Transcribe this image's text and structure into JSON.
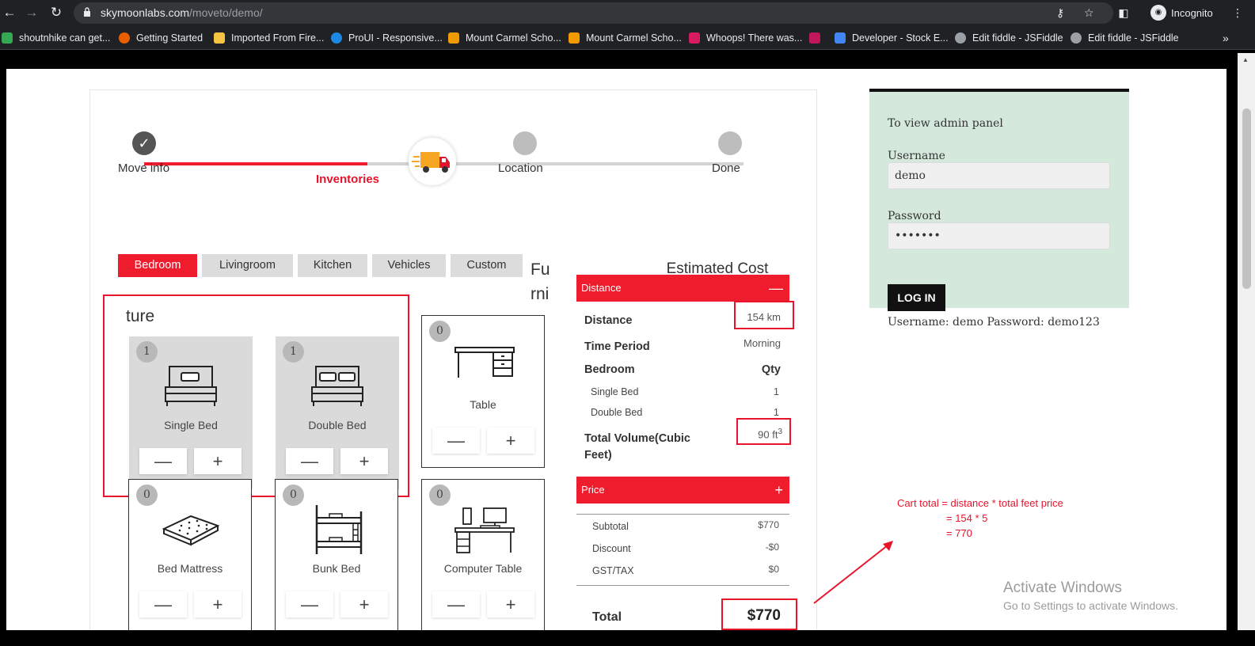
{
  "browser": {
    "url_host": "skymoonlabs.com",
    "url_path": "/moveto/demo/",
    "profile": "Incognito"
  },
  "bookmarks": [
    {
      "label": "shoutnhike can get...",
      "icon": "leaf-icon",
      "color": "#34a853"
    },
    {
      "label": "Getting Started",
      "icon": "firefox-icon",
      "color": "#e66000"
    },
    {
      "label": "Imported From Fire...",
      "icon": "folder-icon",
      "color": "#f6c344"
    },
    {
      "label": "ProUI - Responsive...",
      "icon": "bolt-icon",
      "color": "#1e88e5"
    },
    {
      "label": "Mount Carmel Scho...",
      "icon": "book-icon",
      "color": "#f29900"
    },
    {
      "label": "Mount Carmel Scho...",
      "icon": "book-icon",
      "color": "#f29900"
    },
    {
      "label": "Whoops! There was...",
      "icon": "app-icon",
      "color": "#d81b60"
    },
    {
      "label": "",
      "icon": "app-icon",
      "color": "#c2185b"
    },
    {
      "label": "Developer - Stock E...",
      "icon": "doc-icon",
      "color": "#4285f4"
    },
    {
      "label": "Edit fiddle - JSFiddle",
      "icon": "globe-icon",
      "color": "#9aa0a6"
    },
    {
      "label": "Edit fiddle - JSFiddle",
      "icon": "globe-icon",
      "color": "#9aa0a6"
    }
  ],
  "steps": [
    {
      "label": "Move info",
      "state": "done"
    },
    {
      "label": "Inventories",
      "state": "active"
    },
    {
      "label": "Location",
      "state": "pending"
    },
    {
      "label": "Done",
      "state": "pending"
    }
  ],
  "tabs": [
    "Bedroom",
    "Livingroom",
    "Kitchen",
    "Vehicles",
    "Custom"
  ],
  "category_title_part1": "Fu rni",
  "category_title_part2": "ture",
  "items": [
    {
      "name": "Single Bed",
      "qty": "1",
      "icon": "single-bed-icon"
    },
    {
      "name": "Double Bed",
      "qty": "1",
      "icon": "double-bed-icon"
    },
    {
      "name": "Table",
      "qty": "0",
      "icon": "table-icon"
    },
    {
      "name": "Bed Mattress",
      "qty": "0",
      "icon": "mattress-icon"
    },
    {
      "name": "Bunk Bed",
      "qty": "0",
      "icon": "bunk-bed-icon"
    },
    {
      "name": "Computer Table",
      "qty": "0",
      "icon": "computer-table-icon"
    }
  ],
  "buttons": {
    "minus": "—",
    "plus": "+"
  },
  "estimate": {
    "title": "Estimated Cost",
    "distance_bar": "Distance",
    "distance_label": "Distance",
    "distance_value": "154 km",
    "time_label": "Time Period",
    "time_value": "Morning",
    "room_label": "Bedroom",
    "qty_label": "Qty",
    "line_items": [
      {
        "name": "Single Bed",
        "qty": "1"
      },
      {
        "name": "Double Bed",
        "qty": "1"
      }
    ],
    "volume_label": "Total Volume(Cubic Feet)",
    "volume_value": "90 ft",
    "volume_sup": "3",
    "price_bar": "Price",
    "subtotal_label": "Subtotal",
    "subtotal_value": "$770",
    "discount_label": "Discount",
    "discount_value": "-$0",
    "tax_label": "GST/TAX",
    "tax_value": "$0",
    "total_label": "Total",
    "total_value": "$770"
  },
  "login": {
    "intro": "To view admin panel",
    "username_label": "Username",
    "username_value": "demo",
    "password_label": "Password",
    "password_value": "•••••••",
    "button": "LOG IN",
    "credentials": "Username: demo  Password: demo123"
  },
  "annotation": {
    "line1": "Cart total = distance * total feet price",
    "line2": "= 154 * 5",
    "line3": "= 770"
  },
  "watermark": {
    "title": "Activate Windows",
    "subtitle": "Go to Settings to activate Windows."
  }
}
